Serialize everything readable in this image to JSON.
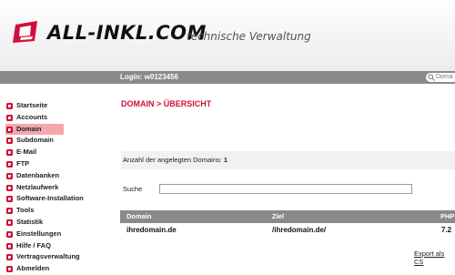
{
  "header": {
    "logo_text": "ALL-INKL.COM",
    "tagline": "technische Verwaltung",
    "brand_color": "#d0103a"
  },
  "topbar": {
    "login": "Login: w0123456",
    "search_placeholder": "Doma",
    "search_icon": "search-icon"
  },
  "sidebar": {
    "items": [
      {
        "label": "Startseite",
        "active": false
      },
      {
        "label": "Accounts",
        "active": false
      },
      {
        "label": "Domain",
        "active": true
      },
      {
        "label": "Subdomain",
        "active": false
      },
      {
        "label": "E-Mail",
        "active": false
      },
      {
        "label": "FTP",
        "active": false
      },
      {
        "label": "Datenbanken",
        "active": false
      },
      {
        "label": "Netzlaufwerk",
        "active": false
      },
      {
        "label": "Software-Installation",
        "active": false
      },
      {
        "label": "Tools",
        "active": false
      },
      {
        "label": "Statistik",
        "active": false
      },
      {
        "label": "Einstellungen",
        "active": false
      },
      {
        "label": "Hilfe / FAQ",
        "active": false
      },
      {
        "label": "Vertragsverwaltung",
        "active": false
      },
      {
        "label": "Abmelden",
        "active": false
      }
    ]
  },
  "main": {
    "title": "DOMAIN > ÜBERSICHT",
    "count_label": "Anzahl der angelegten Domains:",
    "count_value": "1",
    "search_label": "Suche",
    "table": {
      "headers": [
        "Domain",
        "Ziel",
        "PHP"
      ],
      "rows": [
        [
          "ihredomain.de",
          "/ihredomain.de/",
          "7.2"
        ]
      ]
    },
    "export_link": "Export als CS"
  }
}
